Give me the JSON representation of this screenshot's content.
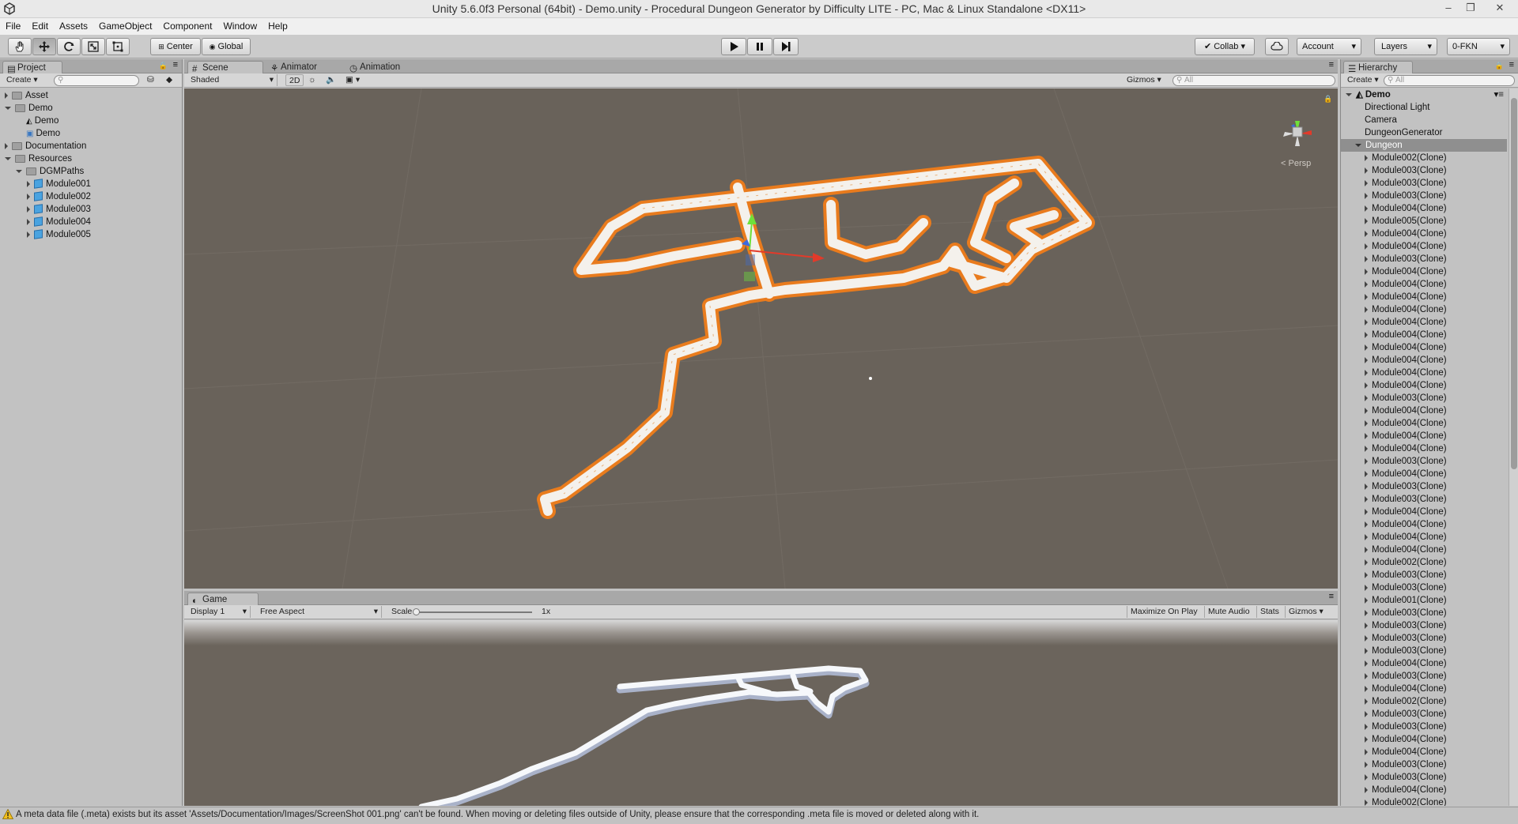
{
  "window": {
    "title": "Unity 5.6.0f3 Personal (64bit) - Demo.unity - Procedural Dungeon Generator by Difficulty LITE - PC, Mac & Linux Standalone <DX11>",
    "minimize": "–",
    "restore": "❐",
    "close": "✕"
  },
  "menu": [
    "File",
    "Edit",
    "Assets",
    "GameObject",
    "Component",
    "Window",
    "Help"
  ],
  "toolbar": {
    "pivot": "Center",
    "space": "Global",
    "collab": "Collab",
    "account": "Account",
    "layers": "Layers",
    "layout": "0-FKN"
  },
  "project": {
    "tab": "Project",
    "create": "Create",
    "items": [
      {
        "label": "Asset",
        "depth": 0,
        "kind": "folder",
        "open": false
      },
      {
        "label": "Demo",
        "depth": 0,
        "kind": "folder",
        "open": true
      },
      {
        "label": "Demo",
        "depth": 1,
        "kind": "unity",
        "open": null
      },
      {
        "label": "Demo",
        "depth": 1,
        "kind": "script",
        "open": null
      },
      {
        "label": "Documentation",
        "depth": 0,
        "kind": "folder",
        "open": false
      },
      {
        "label": "Resources",
        "depth": 0,
        "kind": "folder",
        "open": true
      },
      {
        "label": "DGMPaths",
        "depth": 1,
        "kind": "folder",
        "open": true
      },
      {
        "label": "Module001",
        "depth": 2,
        "kind": "prefab",
        "open": false
      },
      {
        "label": "Module002",
        "depth": 2,
        "kind": "prefab",
        "open": false
      },
      {
        "label": "Module003",
        "depth": 2,
        "kind": "prefab",
        "open": false
      },
      {
        "label": "Module004",
        "depth": 2,
        "kind": "prefab",
        "open": false
      },
      {
        "label": "Module005",
        "depth": 2,
        "kind": "prefab",
        "open": false
      }
    ]
  },
  "scene": {
    "tabs": [
      "Scene",
      "Animator",
      "Animation"
    ],
    "shading": "Shaded",
    "mode2d": "2D",
    "gizmos": "Gizmos",
    "search_placeholder": "All",
    "persp": "Persp"
  },
  "game": {
    "tab": "Game",
    "display": "Display 1",
    "aspect": "Free Aspect",
    "scale_label": "Scale",
    "scale_value": "1x",
    "maximize": "Maximize On Play",
    "mute": "Mute Audio",
    "stats": "Stats",
    "gizmos": "Gizmos"
  },
  "hierarchy": {
    "tab": "Hierarchy",
    "create": "Create",
    "search_placeholder": "All",
    "scene": "Demo",
    "roots": [
      "Directional Light",
      "Camera",
      "DungeonGenerator",
      "Dungeon"
    ],
    "children": [
      "Module002(Clone)",
      "Module003(Clone)",
      "Module003(Clone)",
      "Module003(Clone)",
      "Module004(Clone)",
      "Module005(Clone)",
      "Module004(Clone)",
      "Module004(Clone)",
      "Module003(Clone)",
      "Module004(Clone)",
      "Module004(Clone)",
      "Module004(Clone)",
      "Module004(Clone)",
      "Module004(Clone)",
      "Module004(Clone)",
      "Module004(Clone)",
      "Module004(Clone)",
      "Module004(Clone)",
      "Module004(Clone)",
      "Module003(Clone)",
      "Module004(Clone)",
      "Module004(Clone)",
      "Module004(Clone)",
      "Module004(Clone)",
      "Module003(Clone)",
      "Module004(Clone)",
      "Module003(Clone)",
      "Module003(Clone)",
      "Module004(Clone)",
      "Module004(Clone)",
      "Module004(Clone)",
      "Module004(Clone)",
      "Module002(Clone)",
      "Module003(Clone)",
      "Module003(Clone)",
      "Module001(Clone)",
      "Module003(Clone)",
      "Module003(Clone)",
      "Module003(Clone)",
      "Module003(Clone)",
      "Module004(Clone)",
      "Module003(Clone)",
      "Module004(Clone)",
      "Module002(Clone)",
      "Module003(Clone)",
      "Module003(Clone)",
      "Module004(Clone)",
      "Module004(Clone)",
      "Module003(Clone)",
      "Module003(Clone)",
      "Module004(Clone)",
      "Module002(Clone)"
    ]
  },
  "status": {
    "message": "A meta data file (.meta) exists but its asset 'Assets/Documentation/Images/ScreenShot 001.png' can't be found. When moving or deleting files outside of Unity, please ensure that the corresponding .meta file is moved or deleted along with it."
  },
  "colors": {
    "selection_outline": "#f07d1a",
    "scene_bg": "#69625a",
    "panel": "#c2c2c2"
  }
}
